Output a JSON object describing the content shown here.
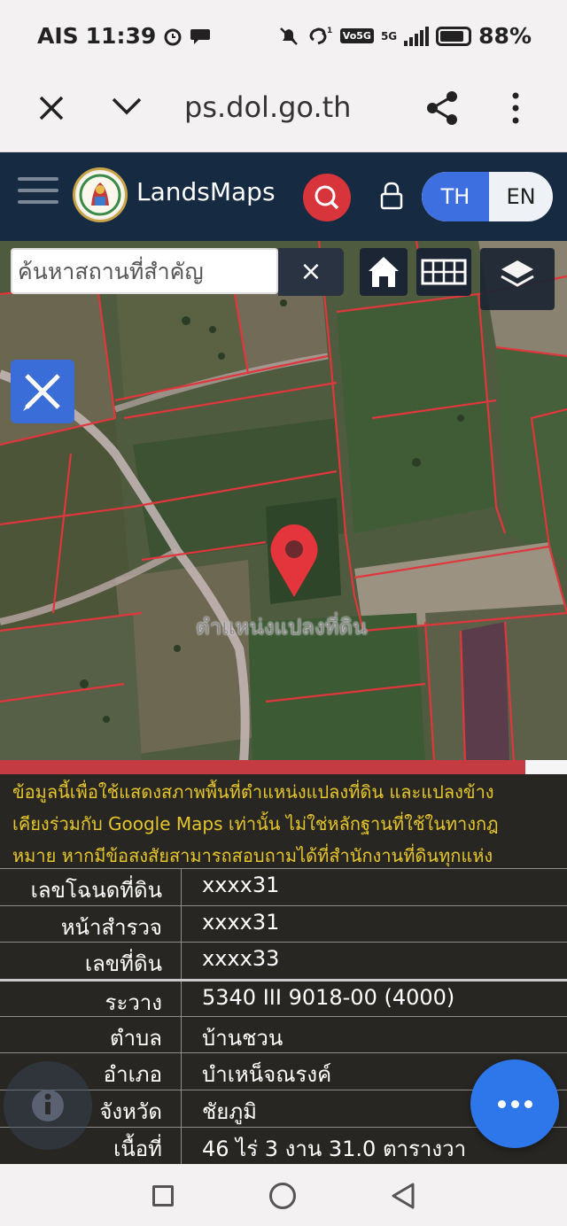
{
  "status": {
    "carrier": "AIS",
    "time": "11:39",
    "network_badge": "Vo5G",
    "network_type": "5G",
    "battery": "88%"
  },
  "browser": {
    "url": "ps.dol.go.th",
    "icons": [
      "close-icon",
      "chevron-down-icon",
      "share-icon",
      "more-vert-icon"
    ]
  },
  "app": {
    "brand": "LandsMaps",
    "lang_th": "TH",
    "lang_en": "EN",
    "active_lang": "TH"
  },
  "map": {
    "search_placeholder": "ค้นหาสถานที่สำคัญ",
    "clear_label": "×",
    "pin_label": "ตำแหน่งแปลงที่ดิน",
    "progress": 0.926,
    "colors": {
      "parcel_line": "#e0363c",
      "pin": "#e4343c",
      "road": "#c8b8b8"
    }
  },
  "disclaimer": {
    "line1": "ข้อมูลนี้เพื่อใช้แสดงสภาพพื้นที่ตำแหน่งแปลงที่ดิน และแปลงข้าง",
    "line2": "เคียงร่วมกับ Google Maps เท่านั้น ไม่ใช่หลักฐานที่ใช้ในทางกฎ",
    "line3": "หมาย หากมีข้อสงสัยสามารถสอบถามได้ที่สำนักงานที่ดินทุกแห่ง"
  },
  "details": [
    {
      "key": "เลขโฉนดที่ดิน",
      "value": "xxxx31"
    },
    {
      "key": "หน้าสำรวจ",
      "value": "xxxx31"
    },
    {
      "key": "เลขที่ดิน",
      "value": "xxxx33"
    },
    {
      "key": "ระวาง",
      "value": "5340 III 9018-00 (4000)"
    },
    {
      "key": "ตำบล",
      "value": "บ้านชวน"
    },
    {
      "key": "อำเภอ",
      "value": "บำเหน็จณรงค์"
    },
    {
      "key": "จังหวัด",
      "value": "ชัยภูมิ"
    },
    {
      "key": "เนื้อที่",
      "value": "46 ไร่ 3 งาน 31.0 ตารางวา"
    }
  ]
}
